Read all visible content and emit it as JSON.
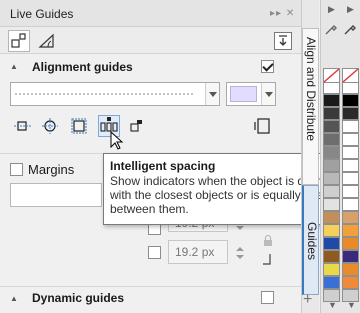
{
  "panel": {
    "title": "Live Guides",
    "titlebar_buttons": "▸▸ ✕",
    "tabs": [
      {
        "name": "guides-tab",
        "selected": true
      },
      {
        "name": "angle-tab",
        "selected": false
      }
    ]
  },
  "alignment": {
    "title": "Alignment guides",
    "checked": true,
    "line_style": "",
    "swatch_color": "#e2dcff",
    "tool_buttons": [
      {
        "name": "edge-alignment-icon"
      },
      {
        "name": "center-alignment-icon"
      },
      {
        "name": "object-bounds-icon"
      },
      {
        "name": "intelligent-spacing-icon",
        "hovered": true
      },
      {
        "name": "intelligent-dimensioning-icon"
      },
      {
        "name": "page-alignment-icon"
      }
    ]
  },
  "margins": {
    "label": "Margins",
    "checked": false,
    "value_a": "19.2 px",
    "value_b": "19.2 px"
  },
  "tooltip": {
    "title": "Intelligent spacing",
    "body": "Show indicators when the object is distributed with the closest objects or is equally spaced between them."
  },
  "dynamic": {
    "title": "Dynamic guides",
    "checked": false
  },
  "vertical_tabs": {
    "align": "Align and Distribute",
    "guides": "Guides",
    "add": "+"
  },
  "palette": {
    "colors_left": [
      "#bdbdbd",
      "#ffffff",
      "#1a1a1a",
      "#3a3a3a",
      "#555555",
      "#6e6e6e",
      "#878787",
      "#a0a0a0",
      "#b8b8b8",
      "#cfcfcf",
      "#e2e2e2",
      "#c28f5c",
      "#f4d15a",
      "#1f4aa8",
      "#8e5a1f",
      "#e8d94a",
      "#3a6fd8",
      "#cfcfcf"
    ],
    "colors_right": [
      "#bdbdbd",
      "#ffffff",
      "#000000",
      "#2a2a2a",
      "#ffffff",
      "#ffffff",
      "#ffffff",
      "#ffffff",
      "#ffffff",
      "#ffffff",
      "#ffffff",
      "#d8a06a",
      "#f2a13a",
      "#e88a2a",
      "#3b2a7a",
      "#e98a2c",
      "#f08a3a",
      "#cfcfcf"
    ]
  },
  "colors": {
    "accent": "#3a78c2",
    "hover_bg": "#e0ecf8"
  }
}
